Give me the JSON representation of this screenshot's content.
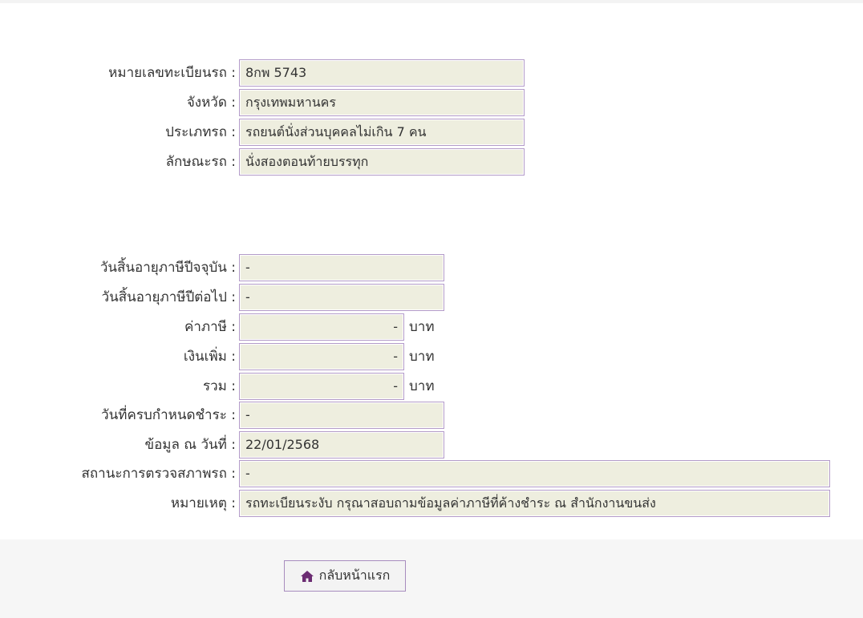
{
  "vehicle": {
    "plate": {
      "label": "หมายเลขทะเบียนรถ :",
      "value": "8กพ 5743"
    },
    "province": {
      "label": "จังหวัด :",
      "value": "กรุงเทพมหานคร"
    },
    "type": {
      "label": "ประเภทรถ :",
      "value": "รถยนต์นั่งส่วนบุคคลไม่เกิน 7 คน"
    },
    "body": {
      "label": "ลักษณะรถ :",
      "value": "นั่งสองตอนท้ายบรรทุก"
    }
  },
  "tax": {
    "current_expiry": {
      "label": "วันสิ้นอายุภาษีปีจจุบัน :",
      "value": "-"
    },
    "next_expiry": {
      "label": "วันสิ้นอายุภาษีปีต่อไป :",
      "value": "-"
    },
    "tax_amount": {
      "label": "ค่าภาษี :",
      "value": "-",
      "unit": "บาท"
    },
    "surcharge": {
      "label": "เงินเพิ่ม :",
      "value": "-",
      "unit": "บาท"
    },
    "total": {
      "label": "รวม :",
      "value": "-",
      "unit": "บาท"
    },
    "due_date": {
      "label": "วันที่ครบกำหนดชำระ :",
      "value": "-"
    },
    "data_as_of": {
      "label": "ข้อมูล ณ วันที่ :",
      "value": "22/01/2568"
    },
    "inspection_status": {
      "label": "สถานะการตรวจสภาพรถ :",
      "value": "-"
    },
    "remark": {
      "label": "หมายเหตุ :",
      "value": "รถทะเบียนระงับ กรุณาสอบถามข้อมูลค่าภาษีที่ค้างชำระ ณ สำนักงานขนส่ง"
    }
  },
  "footer": {
    "home_button_label": "กลับหน้าแรก",
    "home_icon": "home-icon"
  },
  "colors": {
    "field_bg": "#eeeedf",
    "field_border": "#b39bc8",
    "accent": "#6b2c72"
  }
}
